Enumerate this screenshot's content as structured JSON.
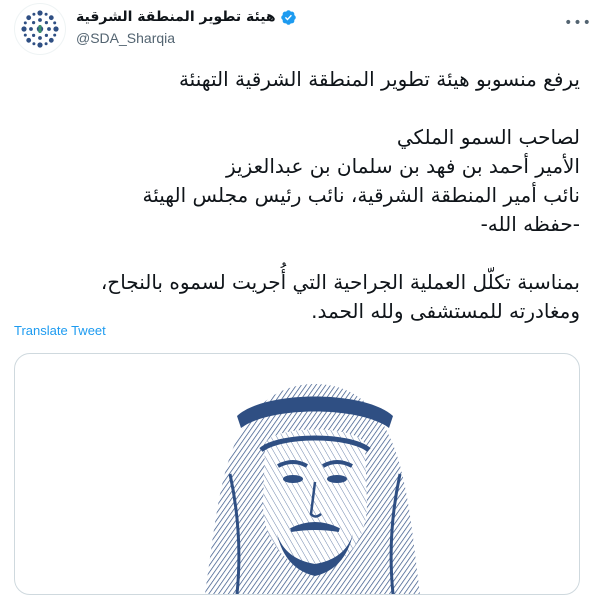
{
  "tweet": {
    "author": {
      "display_name": "هيئة تطوير المنطقة الشرقية",
      "handle": "@SDA_Sharqia",
      "verified": true,
      "avatar_icon": "sda-logo-icon"
    },
    "more_icon": "more-options-icon",
    "lines": [
      "يرفع منسوبو هيئة تطوير المنطقة الشرقية التهنئة",
      "",
      "لصاحب السمو الملكي",
      "الأمير أحمد بن فهد بن سلمان بن عبدالعزيز",
      "نائب أمير المنطقة الشرقية، نائب رئيس مجلس الهيئة",
      "-حفظه الله-",
      "",
      "بمناسبة تكلّل العملية الجراحية التي أُجريت لسموه بالنجاح،",
      "ومغادرته للمستشفى ولله الحمد."
    ],
    "translate_label": "Translate Tweet",
    "media": {
      "type": "portrait-illustration",
      "colors": {
        "primary": "#2f4f83",
        "light": "#c9d3e3"
      }
    }
  },
  "colors": {
    "link": "#1d9bf0",
    "secondary_text": "#536471",
    "border": "#cfd9de",
    "verified": "#1d9bf0"
  }
}
